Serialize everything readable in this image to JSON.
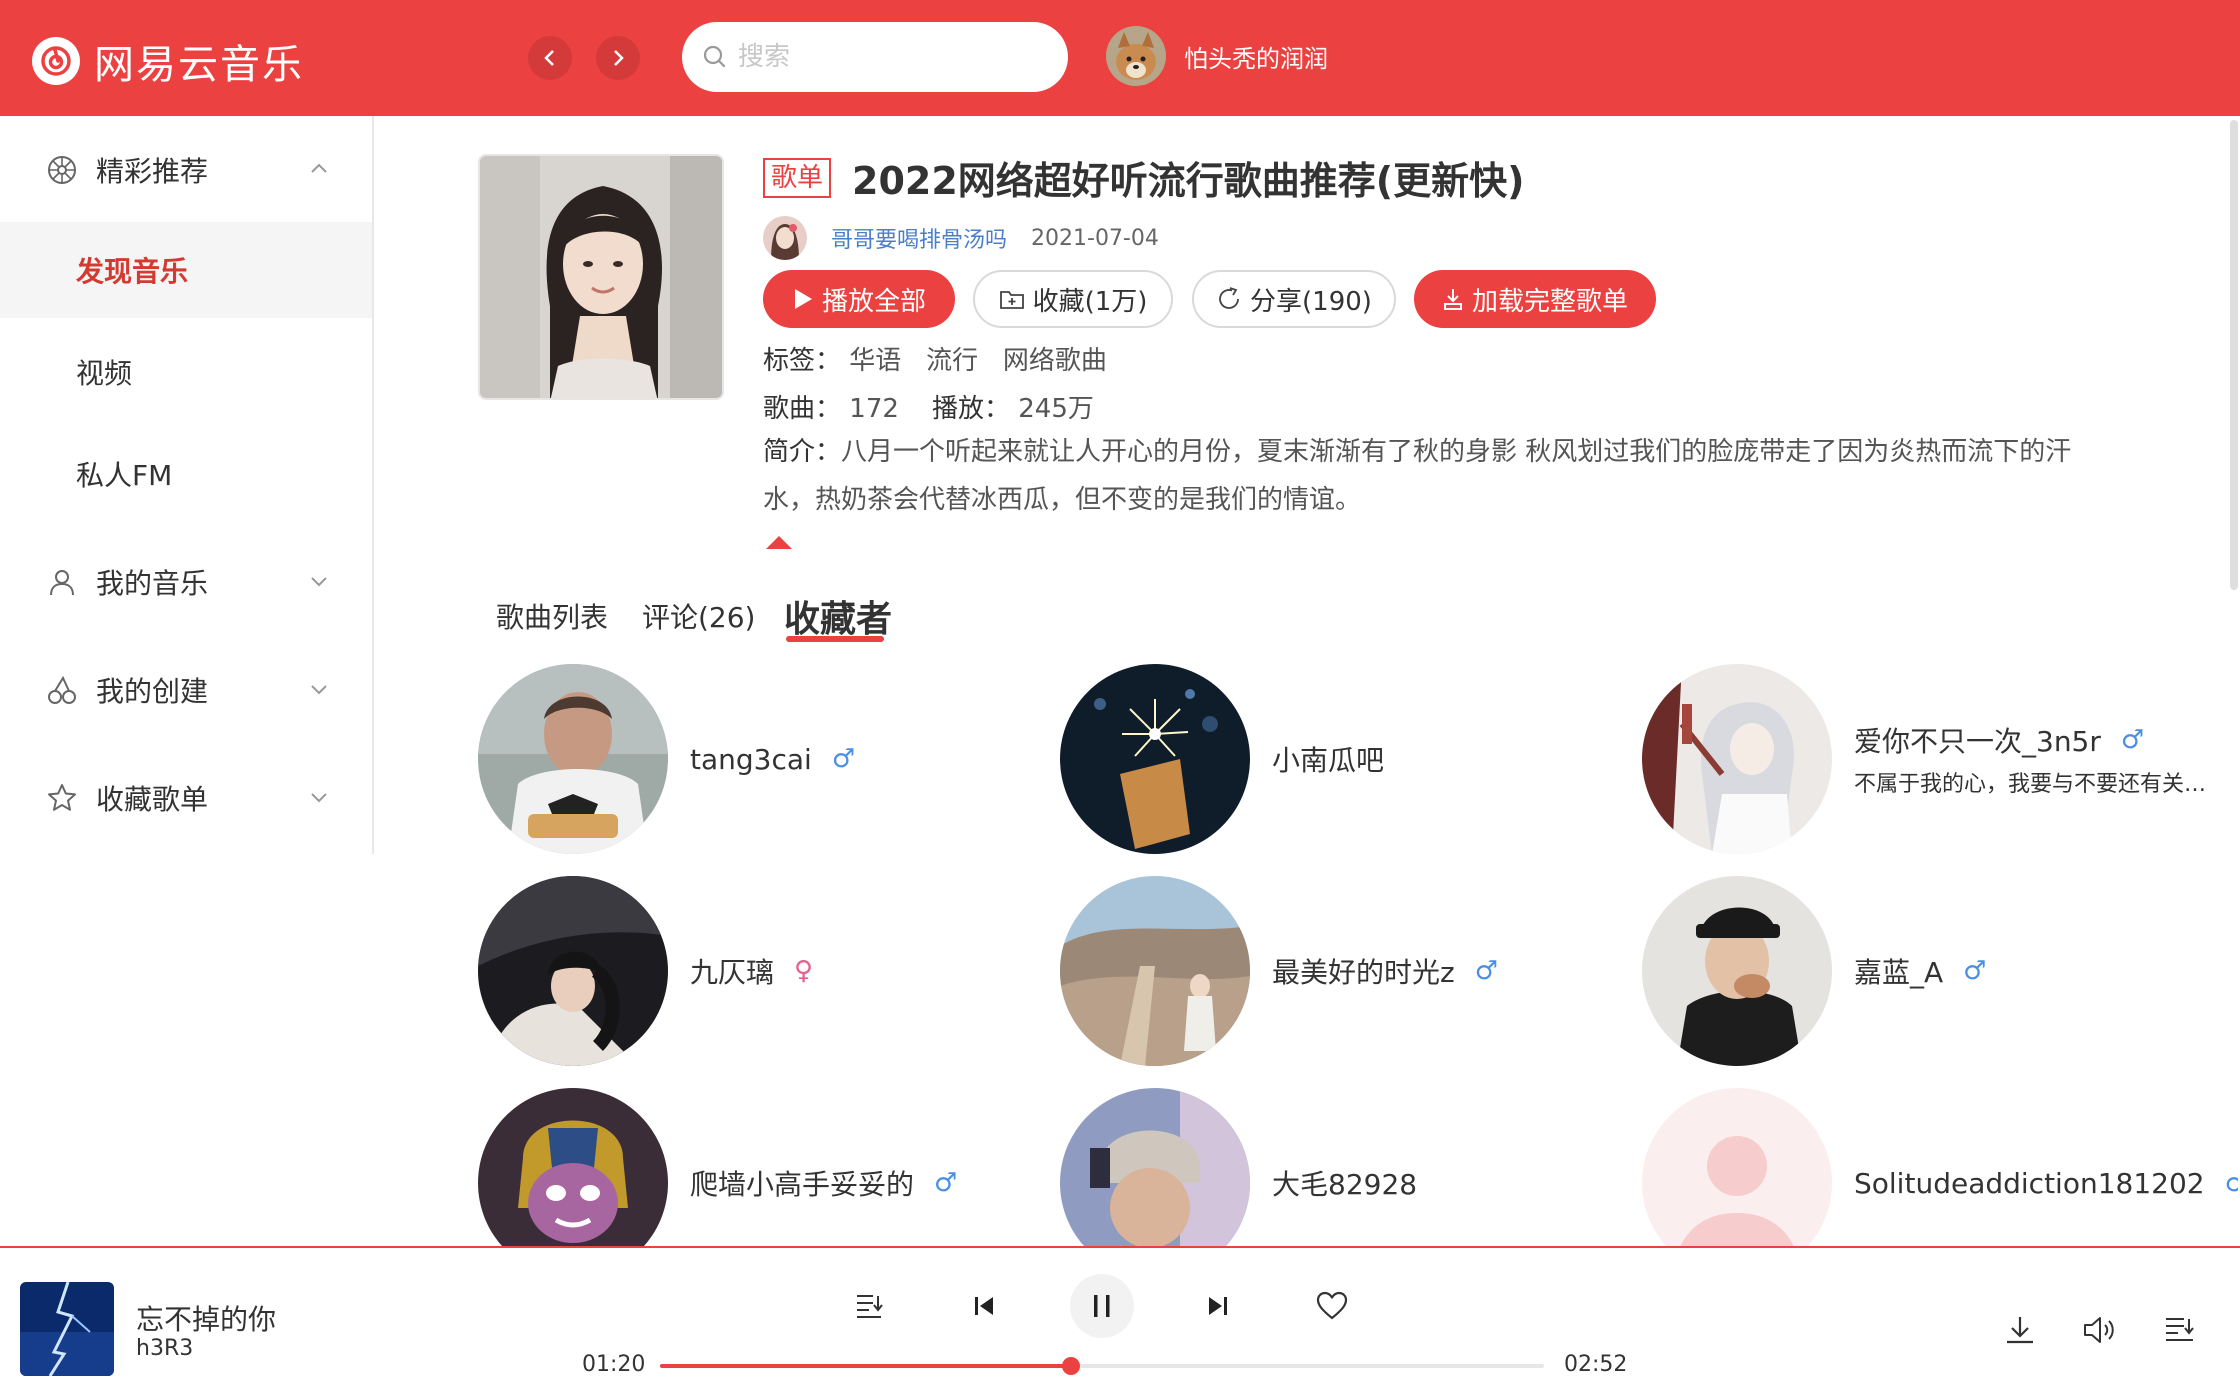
{
  "app": {
    "name": "网易云音乐"
  },
  "header": {
    "search_placeholder": "搜索",
    "user_name": "怕头秃的润润"
  },
  "sidebar": {
    "groups": [
      {
        "label": "精彩推荐",
        "icon": "compass-icon",
        "expanded": true
      },
      {
        "label": "我的音乐",
        "icon": "user-icon",
        "expanded": false
      },
      {
        "label": "我的创建",
        "icon": "cherries-icon",
        "expanded": false
      },
      {
        "label": "收藏歌单",
        "icon": "star-icon",
        "expanded": false
      }
    ],
    "items": [
      {
        "label": "发现音乐",
        "active": true
      },
      {
        "label": "视频",
        "active": false
      },
      {
        "label": "私人FM",
        "active": false
      }
    ]
  },
  "playlist": {
    "tag": "歌单",
    "title": "2022网络超好听流行歌曲推荐(更新快)",
    "creator": "哥哥要喝排骨汤吗",
    "date": "2021-07-04",
    "buttons": {
      "play_all": "播放全部",
      "collect": "收藏(1万)",
      "share": "分享(190)",
      "load_full": "加载完整歌单"
    },
    "tags_label": "标签：",
    "tags": [
      "华语",
      "流行",
      "网络歌曲"
    ],
    "songs_label": "歌曲：",
    "songs_count": "172",
    "plays_label": "播放：",
    "plays_count": "245万",
    "intro_label": "简介：",
    "intro_line1": "八月一个听起来就让人开心的月份，夏末渐渐有了秋的身影 秋风划过我们的脸庞带走了因为炎热而流下的汗",
    "intro_line2": "水，热奶茶会代替冰西瓜，但不变的是我们的情谊。"
  },
  "tabs": [
    {
      "label": "歌曲列表",
      "active": false
    },
    {
      "label": "评论(26)",
      "active": false
    },
    {
      "label": "收藏者",
      "active": true
    }
  ],
  "collectors": [
    {
      "name": "tang3cai",
      "gender": "male",
      "signature": ""
    },
    {
      "name": "小南瓜吧",
      "gender": "",
      "signature": ""
    },
    {
      "name": "爱你不只一次_3n5r",
      "gender": "male",
      "signature": "不属于我的心，我要与不要还有关…"
    },
    {
      "name": "九仄璃",
      "gender": "female",
      "signature": ""
    },
    {
      "name": "最美好的时光z",
      "gender": "male",
      "signature": ""
    },
    {
      "name": "嘉蓝_A",
      "gender": "male",
      "signature": ""
    },
    {
      "name": "爬墙小高手妥妥的",
      "gender": "male",
      "signature": ""
    },
    {
      "name": "大毛82928",
      "gender": "",
      "signature": ""
    },
    {
      "name": "Solitudeaddiction181202",
      "gender": "male",
      "signature": ""
    }
  ],
  "gender_symbols": {
    "male": "♂",
    "female": "♀"
  },
  "player": {
    "song_title": "忘不掉的你",
    "artist": "h3R3",
    "current_time": "01:20",
    "total_time": "02:52",
    "progress": 0.4651
  },
  "colors": {
    "accent": "#ec4141",
    "link": "#4a7fc8",
    "male": "#4a90e2",
    "female": "#e4608f"
  }
}
